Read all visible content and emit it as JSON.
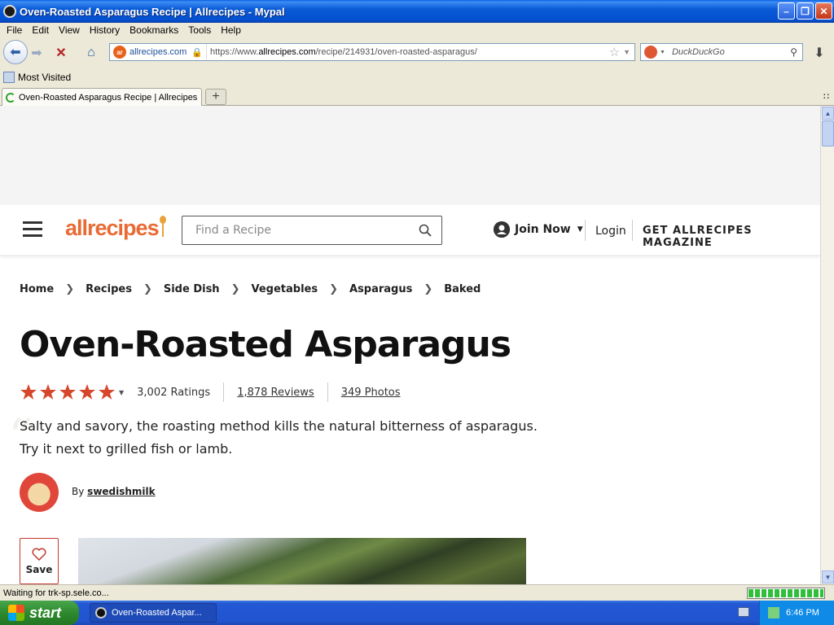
{
  "window": {
    "title": "Oven-Roasted Asparagus Recipe | Allrecipes - Mypal",
    "controls": [
      "minimize",
      "maximize",
      "close"
    ]
  },
  "menubar": [
    "File",
    "Edit",
    "View",
    "History",
    "Bookmarks",
    "Tools",
    "Help"
  ],
  "navbar": {
    "site_label": "allrecipes.com",
    "url_prefix": "https://www.",
    "url_domain": "allrecipes.com",
    "url_path": "/recipe/214931/oven-roasted-asparagus/",
    "search_placeholder": "DuckDuckGo"
  },
  "bookmarks": [
    "Most Visited"
  ],
  "tabs": [
    {
      "label": "Oven-Roasted Asparagus Recipe | Allrecipes",
      "loading": true
    }
  ],
  "site_header": {
    "logo": "allrecipes",
    "search_placeholder": "Find a Recipe",
    "join_now": "Join Now",
    "login": "Login",
    "magazine": "GET ALLRECIPES MAGAZINE"
  },
  "breadcrumb": [
    "Home",
    "Recipes",
    "Side Dish",
    "Vegetables",
    "Asparagus",
    "Baked"
  ],
  "recipe": {
    "title": "Oven-Roasted Asparagus",
    "rating": 5,
    "ratings_count": "3,002 Ratings",
    "reviews": "1,878 Reviews",
    "photos": "349 Photos",
    "description": "Salty and savory, the roasting method kills the natural bitterness of asparagus. Try it next to grilled fish or lamb.",
    "by_label": "By",
    "author": "swedishmilk",
    "save_label": "Save"
  },
  "status": {
    "text": "Waiting for trk-sp.sele.co...",
    "progress": 1.0
  },
  "taskbar": {
    "start": "start",
    "task": "Oven-Roasted Aspar...",
    "clock": "6:46 PM"
  },
  "colors": {
    "accent": "#e86b35",
    "star": "#d6462a",
    "save_border": "#c0392b"
  }
}
